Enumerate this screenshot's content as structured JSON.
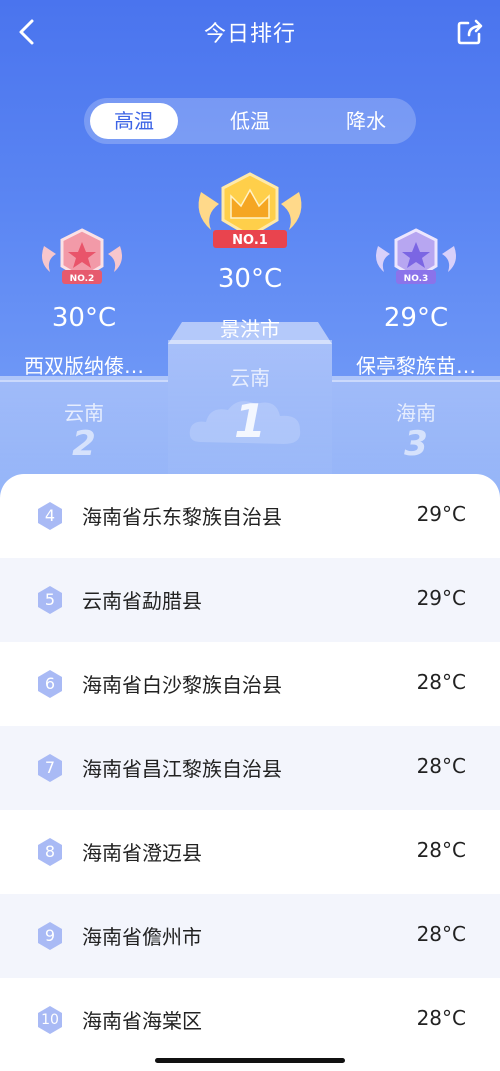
{
  "header": {
    "title": "今日排行",
    "back_icon": "chevron-left-icon",
    "share_icon": "share-icon"
  },
  "tabs": [
    {
      "label": "高温",
      "active": true
    },
    {
      "label": "低温",
      "active": false
    },
    {
      "label": "降水",
      "active": false
    }
  ],
  "podium": {
    "first": {
      "badge": "NO.1",
      "temp": "30°C",
      "city": "景洪市",
      "province": "云南",
      "rank": "1"
    },
    "second": {
      "badge": "NO.2",
      "temp": "30°C",
      "city": "西双版纳傣…",
      "province": "云南",
      "rank": "2"
    },
    "third": {
      "badge": "NO.3",
      "temp": "29°C",
      "city": "保亭黎族苗…",
      "province": "海南",
      "rank": "3"
    }
  },
  "list": [
    {
      "rank": "4",
      "name": "海南省乐东黎族自治县",
      "temp": "29°C"
    },
    {
      "rank": "5",
      "name": "云南省勐腊县",
      "temp": "29°C"
    },
    {
      "rank": "6",
      "name": "海南省白沙黎族自治县",
      "temp": "28°C"
    },
    {
      "rank": "7",
      "name": "海南省昌江黎族自治县",
      "temp": "28°C"
    },
    {
      "rank": "8",
      "name": "海南省澄迈县",
      "temp": "28°C"
    },
    {
      "rank": "9",
      "name": "海南省儋州市",
      "temp": "28°C"
    },
    {
      "rank": "10",
      "name": "海南省海棠区",
      "temp": "28°C"
    }
  ],
  "colors": {
    "accent": "#3d64e6",
    "hero_top": "#4a74ee",
    "rank_hex": "#a9baf5",
    "gold": "#f6b81b"
  }
}
